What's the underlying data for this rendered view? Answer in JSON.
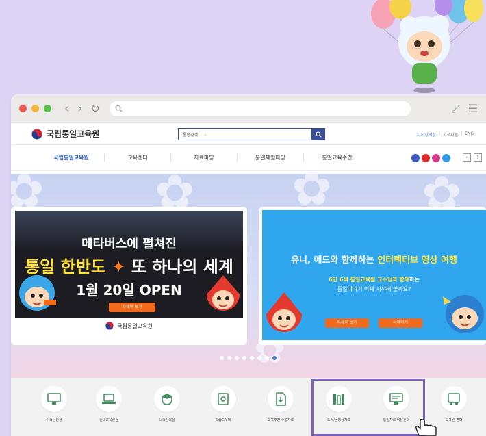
{
  "browser": {
    "address_value": "",
    "icons": [
      "back-icon",
      "forward-icon",
      "reload-icon",
      "search-icon",
      "expand-icon",
      "menu-icon"
    ]
  },
  "site": {
    "logo_text": "국립통일교육원",
    "search": {
      "select_label": "통합검색",
      "value": ""
    },
    "util_links": [
      "나의강의실",
      "고객지원",
      "ENG"
    ]
  },
  "gnb": {
    "items": [
      "국립통일교육원",
      "교육센터",
      "자료마당",
      "통일체험마당",
      "통일교육주간"
    ],
    "zoom": [
      "-",
      "+"
    ]
  },
  "slides": [
    {
      "line1": "메타버스에 펼쳐진",
      "line2a": "통일 한반도",
      "line2b": "또 하나의 세계",
      "line3": "1월 20일 OPEN",
      "button": "자세히 보기",
      "footer": "국립통일교육원"
    },
    {
      "line1a": "유니, 에드와 함께하는",
      "line1b": "인터렉티브 영상 여행",
      "sub1a": "6인 6색 통일교육원 교수님과 함께",
      "sub1b": "하는",
      "sub2": "통일이야기 이제 시작해 볼까요?",
      "button1": "자세히 보기",
      "button2": "시작하기"
    }
  ],
  "pager": {
    "count": 8,
    "active_index": 7
  },
  "quick_menu": [
    {
      "label": "이러닝신청",
      "icon": "monitor-icon"
    },
    {
      "label": "원내교육신청",
      "icon": "laptop-icon"
    },
    {
      "label": "나의강의실",
      "icon": "graduation-cap-icon"
    },
    {
      "label": "학습도우미",
      "icon": "help-icon"
    },
    {
      "label": "교육주간 수업자료",
      "icon": "download-document-icon"
    },
    {
      "label": "도서/동영상자료",
      "icon": "books-icon"
    },
    {
      "label": "통일자료 이용문의",
      "icon": "computer-icon"
    },
    {
      "label": "교육원 견학",
      "icon": "bus-icon"
    }
  ],
  "colors": {
    "background": "#ddd4f5",
    "accent": "#3a4f9c",
    "active_nav": "#3564c2",
    "button_orange": "#f26a1b",
    "highlight_border": "#7b63bd"
  }
}
